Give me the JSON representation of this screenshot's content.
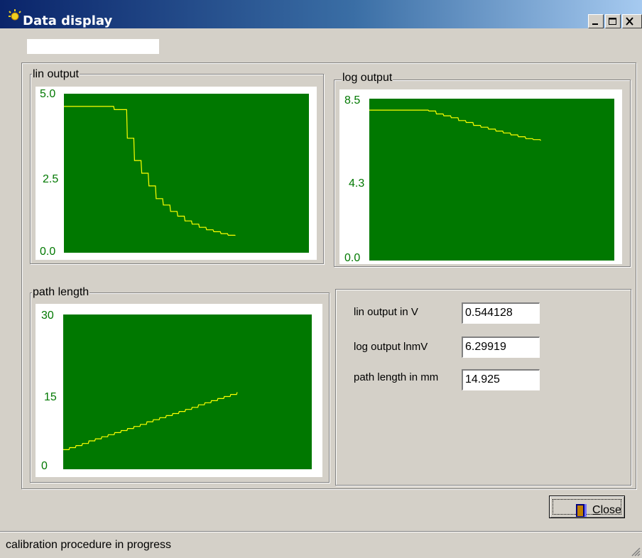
{
  "window": {
    "title": "Data display",
    "icon": "app-sun-icon",
    "controls": [
      "minimize-icon",
      "maximize-icon",
      "close-icon"
    ]
  },
  "colors": {
    "plot_bg": "#007800",
    "trace": "#ffff00",
    "tick_text": "#007800",
    "titlebar": "#0a246a"
  },
  "groups": {
    "lin": {
      "legend": "lin output"
    },
    "log": {
      "legend": "log output"
    },
    "path": {
      "legend": "path length"
    }
  },
  "chart_data": [
    {
      "type": "line",
      "title": "lin output",
      "ylim": [
        0,
        5.0
      ],
      "ytick_labels": [
        "5.0",
        "2.5",
        "0.0"
      ],
      "grid": false,
      "series": [
        {
          "values": [
            4.6,
            4.6,
            4.6,
            4.6,
            4.6,
            4.6,
            4.6,
            4.6,
            4.6,
            4.6,
            4.6,
            4.6,
            4.6,
            4.6,
            4.6,
            4.6,
            4.6,
            4.6,
            4.6,
            4.6,
            4.6,
            4.6,
            4.6,
            4.6,
            4.6,
            4.6,
            4.6,
            4.6,
            4.6,
            4.6,
            4.6,
            4.6,
            4.6,
            4.6,
            4.6,
            4.6,
            4.6,
            4.6,
            4.6,
            4.6,
            4.6,
            4.6,
            4.6,
            4.6,
            4.6,
            4.6,
            4.6,
            4.6,
            4.6,
            4.6,
            4.6,
            4.6,
            4.6,
            4.6,
            4.6,
            4.6,
            4.6,
            4.6,
            4.6,
            4.6,
            4.6,
            4.6,
            4.6,
            4.6,
            4.6,
            4.6,
            4.6,
            4.6,
            4.6,
            4.6,
            4.5,
            4.5,
            4.5,
            4.5,
            4.5,
            4.5,
            4.5,
            4.5,
            4.5,
            4.5,
            4.5,
            4.5,
            4.5,
            4.5,
            4.5,
            4.5,
            4.5,
            4.5,
            3.6,
            3.6,
            3.6,
            3.6,
            3.6,
            3.6,
            3.6,
            3.6,
            3.6,
            3.6,
            2.9,
            2.9,
            2.9,
            2.9,
            2.9,
            2.9,
            2.9,
            2.9,
            2.9,
            2.9,
            2.5,
            2.5,
            2.5,
            2.5,
            2.5,
            2.5,
            2.5,
            2.5,
            2.5,
            2.5,
            2.1,
            2.1,
            2.1,
            2.1,
            2.1,
            2.1,
            2.1,
            2.1,
            2.1,
            2.1,
            1.7,
            1.7,
            1.7,
            1.7,
            1.7,
            1.7,
            1.7,
            1.7,
            1.7,
            1.7,
            1.5,
            1.5,
            1.5,
            1.5,
            1.5,
            1.5,
            1.5,
            1.5,
            1.5,
            1.5,
            1.3,
            1.3,
            1.3,
            1.3,
            1.3,
            1.3,
            1.3,
            1.3,
            1.3,
            1.3,
            1.15,
            1.15,
            1.15,
            1.15,
            1.15,
            1.15,
            1.15,
            1.15,
            1.15,
            1.15,
            1.0,
            1.0,
            1.0,
            1.0,
            1.0,
            1.0,
            1.0,
            1.0,
            1.0,
            1.0,
            0.9,
            0.9,
            0.9,
            0.9,
            0.9,
            0.9,
            0.9,
            0.9,
            0.9,
            0.9,
            0.8,
            0.8,
            0.8,
            0.8,
            0.8,
            0.8,
            0.8,
            0.8,
            0.8,
            0.8,
            0.72,
            0.72,
            0.72,
            0.72,
            0.72,
            0.72,
            0.72,
            0.72,
            0.72,
            0.72,
            0.66,
            0.66,
            0.66,
            0.66,
            0.66,
            0.66,
            0.66,
            0.66,
            0.66,
            0.66,
            0.6,
            0.6,
            0.6,
            0.6,
            0.6,
            0.6,
            0.6,
            0.6,
            0.6,
            0.6,
            0.55,
            0.55,
            0.55,
            0.55,
            0.55,
            0.55,
            0.55,
            0.55,
            0.55,
            0.55,
            0.544
          ],
          "x_max": 345
        }
      ]
    },
    {
      "type": "line",
      "title": "log output",
      "ylim": [
        0,
        8.5
      ],
      "ytick_labels": [
        "8.5",
        "4.3",
        "0.0"
      ],
      "grid": false,
      "series": [
        {
          "values": [
            7.9,
            7.9,
            7.9,
            7.9,
            7.9,
            7.9,
            7.9,
            7.9,
            7.9,
            7.9,
            7.9,
            7.9,
            7.9,
            7.9,
            7.9,
            7.9,
            7.9,
            7.9,
            7.9,
            7.9,
            7.9,
            7.9,
            7.9,
            7.9,
            7.9,
            7.9,
            7.9,
            7.9,
            7.9,
            7.9,
            7.9,
            7.9,
            7.9,
            7.9,
            7.9,
            7.9,
            7.9,
            7.9,
            7.9,
            7.9,
            7.9,
            7.9,
            7.9,
            7.9,
            7.9,
            7.9,
            7.9,
            7.9,
            7.9,
            7.9,
            7.9,
            7.9,
            7.9,
            7.9,
            7.9,
            7.9,
            7.9,
            7.9,
            7.9,
            7.9,
            7.9,
            7.9,
            7.9,
            7.9,
            7.9,
            7.9,
            7.9,
            7.9,
            7.9,
            7.9,
            7.9,
            7.9,
            7.9,
            7.9,
            7.9,
            7.9,
            7.9,
            7.9,
            7.9,
            7.9,
            7.85,
            7.85,
            7.85,
            7.85,
            7.85,
            7.85,
            7.85,
            7.85,
            7.85,
            7.85,
            7.7,
            7.7,
            7.7,
            7.7,
            7.7,
            7.7,
            7.7,
            7.7,
            7.7,
            7.7,
            7.6,
            7.6,
            7.6,
            7.6,
            7.6,
            7.6,
            7.6,
            7.6,
            7.6,
            7.6,
            7.5,
            7.5,
            7.5,
            7.5,
            7.5,
            7.5,
            7.5,
            7.5,
            7.5,
            7.5,
            7.35,
            7.35,
            7.35,
            7.35,
            7.35,
            7.35,
            7.35,
            7.35,
            7.35,
            7.35,
            7.25,
            7.25,
            7.25,
            7.25,
            7.25,
            7.25,
            7.25,
            7.25,
            7.25,
            7.25,
            7.1,
            7.1,
            7.1,
            7.1,
            7.1,
            7.1,
            7.1,
            7.1,
            7.1,
            7.1,
            7.0,
            7.0,
            7.0,
            7.0,
            7.0,
            7.0,
            7.0,
            7.0,
            7.0,
            7.0,
            6.9,
            6.9,
            6.9,
            6.9,
            6.9,
            6.9,
            6.9,
            6.9,
            6.9,
            6.9,
            6.8,
            6.8,
            6.8,
            6.8,
            6.8,
            6.8,
            6.8,
            6.8,
            6.8,
            6.8,
            6.7,
            6.7,
            6.7,
            6.7,
            6.7,
            6.7,
            6.7,
            6.7,
            6.7,
            6.7,
            6.6,
            6.6,
            6.6,
            6.6,
            6.6,
            6.6,
            6.6,
            6.6,
            6.6,
            6.6,
            6.5,
            6.5,
            6.5,
            6.5,
            6.5,
            6.5,
            6.5,
            6.5,
            6.5,
            6.5,
            6.4,
            6.4,
            6.4,
            6.4,
            6.4,
            6.4,
            6.4,
            6.4,
            6.4,
            6.4,
            6.35,
            6.35,
            6.35,
            6.35,
            6.35,
            6.35,
            6.35,
            6.35,
            6.35,
            6.35,
            6.3
          ],
          "x_max": 345
        }
      ]
    },
    {
      "type": "line",
      "title": "path length",
      "ylim": [
        0,
        30
      ],
      "ytick_labels": [
        "30",
        "15",
        "0"
      ],
      "grid": false,
      "series": [
        {
          "values": [
            3.8,
            3.8,
            3.8,
            3.8,
            3.8,
            3.8,
            3.8,
            3.8,
            3.8,
            3.8,
            4.2,
            4.2,
            4.2,
            4.2,
            4.2,
            4.2,
            4.2,
            4.2,
            4.2,
            4.2,
            4.6,
            4.6,
            4.6,
            4.6,
            4.6,
            4.6,
            4.6,
            4.6,
            4.6,
            4.6,
            5.0,
            5.0,
            5.0,
            5.0,
            5.0,
            5.0,
            5.0,
            5.0,
            5.0,
            5.0,
            5.5,
            5.5,
            5.5,
            5.5,
            5.5,
            5.5,
            5.5,
            5.5,
            5.5,
            5.5,
            5.9,
            5.9,
            5.9,
            5.9,
            5.9,
            5.9,
            5.9,
            5.9,
            5.9,
            5.9,
            6.3,
            6.3,
            6.3,
            6.3,
            6.3,
            6.3,
            6.3,
            6.3,
            6.3,
            6.3,
            6.7,
            6.7,
            6.7,
            6.7,
            6.7,
            6.7,
            6.7,
            6.7,
            6.7,
            6.7,
            7.1,
            7.1,
            7.1,
            7.1,
            7.1,
            7.1,
            7.1,
            7.1,
            7.1,
            7.1,
            7.5,
            7.5,
            7.5,
            7.5,
            7.5,
            7.5,
            7.5,
            7.5,
            7.5,
            7.5,
            7.9,
            7.9,
            7.9,
            7.9,
            7.9,
            7.9,
            7.9,
            7.9,
            7.9,
            7.9,
            8.3,
            8.3,
            8.3,
            8.3,
            8.3,
            8.3,
            8.3,
            8.3,
            8.3,
            8.3,
            8.7,
            8.7,
            8.7,
            8.7,
            8.7,
            8.7,
            8.7,
            8.7,
            8.7,
            8.7,
            9.2,
            9.2,
            9.2,
            9.2,
            9.2,
            9.2,
            9.2,
            9.2,
            9.2,
            9.2,
            9.6,
            9.6,
            9.6,
            9.6,
            9.6,
            9.6,
            9.6,
            9.6,
            9.6,
            9.6,
            10.0,
            10.0,
            10.0,
            10.0,
            10.0,
            10.0,
            10.0,
            10.0,
            10.0,
            10.0,
            10.4,
            10.4,
            10.4,
            10.4,
            10.4,
            10.4,
            10.4,
            10.4,
            10.4,
            10.4,
            10.8,
            10.8,
            10.8,
            10.8,
            10.8,
            10.8,
            10.8,
            10.8,
            10.8,
            10.8,
            11.2,
            11.2,
            11.2,
            11.2,
            11.2,
            11.2,
            11.2,
            11.2,
            11.2,
            11.2,
            11.6,
            11.6,
            11.6,
            11.6,
            11.6,
            11.6,
            11.6,
            11.6,
            11.6,
            11.6,
            12.0,
            12.0,
            12.0,
            12.0,
            12.0,
            12.0,
            12.0,
            12.0,
            12.0,
            12.0,
            12.5,
            12.5,
            12.5,
            12.5,
            12.5,
            12.5,
            12.5,
            12.5,
            12.5,
            12.5,
            12.9,
            12.9,
            12.9,
            12.9,
            12.9,
            12.9,
            12.9,
            12.9,
            12.9,
            12.9,
            13.3,
            13.3,
            13.3,
            13.3,
            13.3,
            13.3,
            13.3,
            13.3,
            13.3,
            13.3,
            13.7,
            13.7,
            13.7,
            13.7,
            13.7,
            13.7,
            13.7,
            13.7,
            13.7,
            13.7,
            14.1,
            14.1,
            14.1,
            14.1,
            14.1,
            14.1,
            14.1,
            14.1,
            14.1,
            14.1,
            14.5,
            14.5,
            14.5,
            14.5,
            14.5,
            14.5,
            14.5,
            14.5,
            14.5,
            14.5,
            14.925
          ],
          "x_max": 345
        }
      ]
    }
  ],
  "readouts": {
    "lin_label": "lin output in V",
    "lin_value": "0.544128",
    "log_label": "log output lnmV",
    "log_value": "6.29919",
    "path_label": "path length in mm",
    "path_value": "14.925"
  },
  "close_button": {
    "label_underlined": "C",
    "label_rest": "lose",
    "icon": "door-icon"
  },
  "status": {
    "text": "calibration procedure in progress"
  }
}
